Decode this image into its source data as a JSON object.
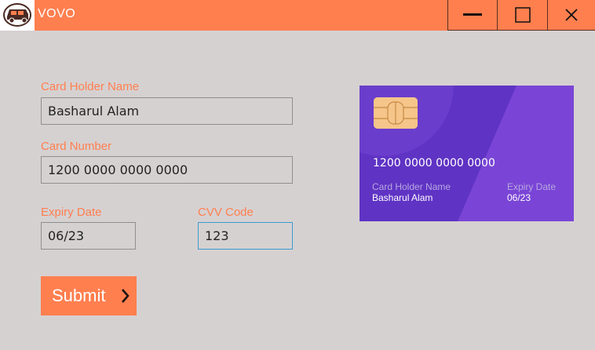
{
  "window": {
    "title": "VOVO",
    "icon": "bus-logo-icon"
  },
  "controls": {
    "minimize": "minimize-icon",
    "maximize": "maximize-icon",
    "close": "close-icon"
  },
  "form": {
    "holder_label": "Card Holder Name",
    "holder_value": "Basharul Alam",
    "number_label": "Card Number",
    "number_value": "1200 0000 0000 0000",
    "expiry_label": "Expiry Date",
    "expiry_value": "06/23",
    "cvv_label": "CVV Code",
    "cvv_value": "123",
    "submit_label": "Submit"
  },
  "card": {
    "number": "1200 0000 0000 0000",
    "holder_label": "Card Holder Name",
    "holder": "Basharul Alam",
    "expiry_label": "Expiry Date",
    "expiry": "06/23"
  },
  "colors": {
    "accent": "#ff7f4f",
    "background": "#d6d1d1",
    "card": "#5f33c4",
    "chip": "#f5c58a",
    "focus_border": "#3a9ccf"
  }
}
